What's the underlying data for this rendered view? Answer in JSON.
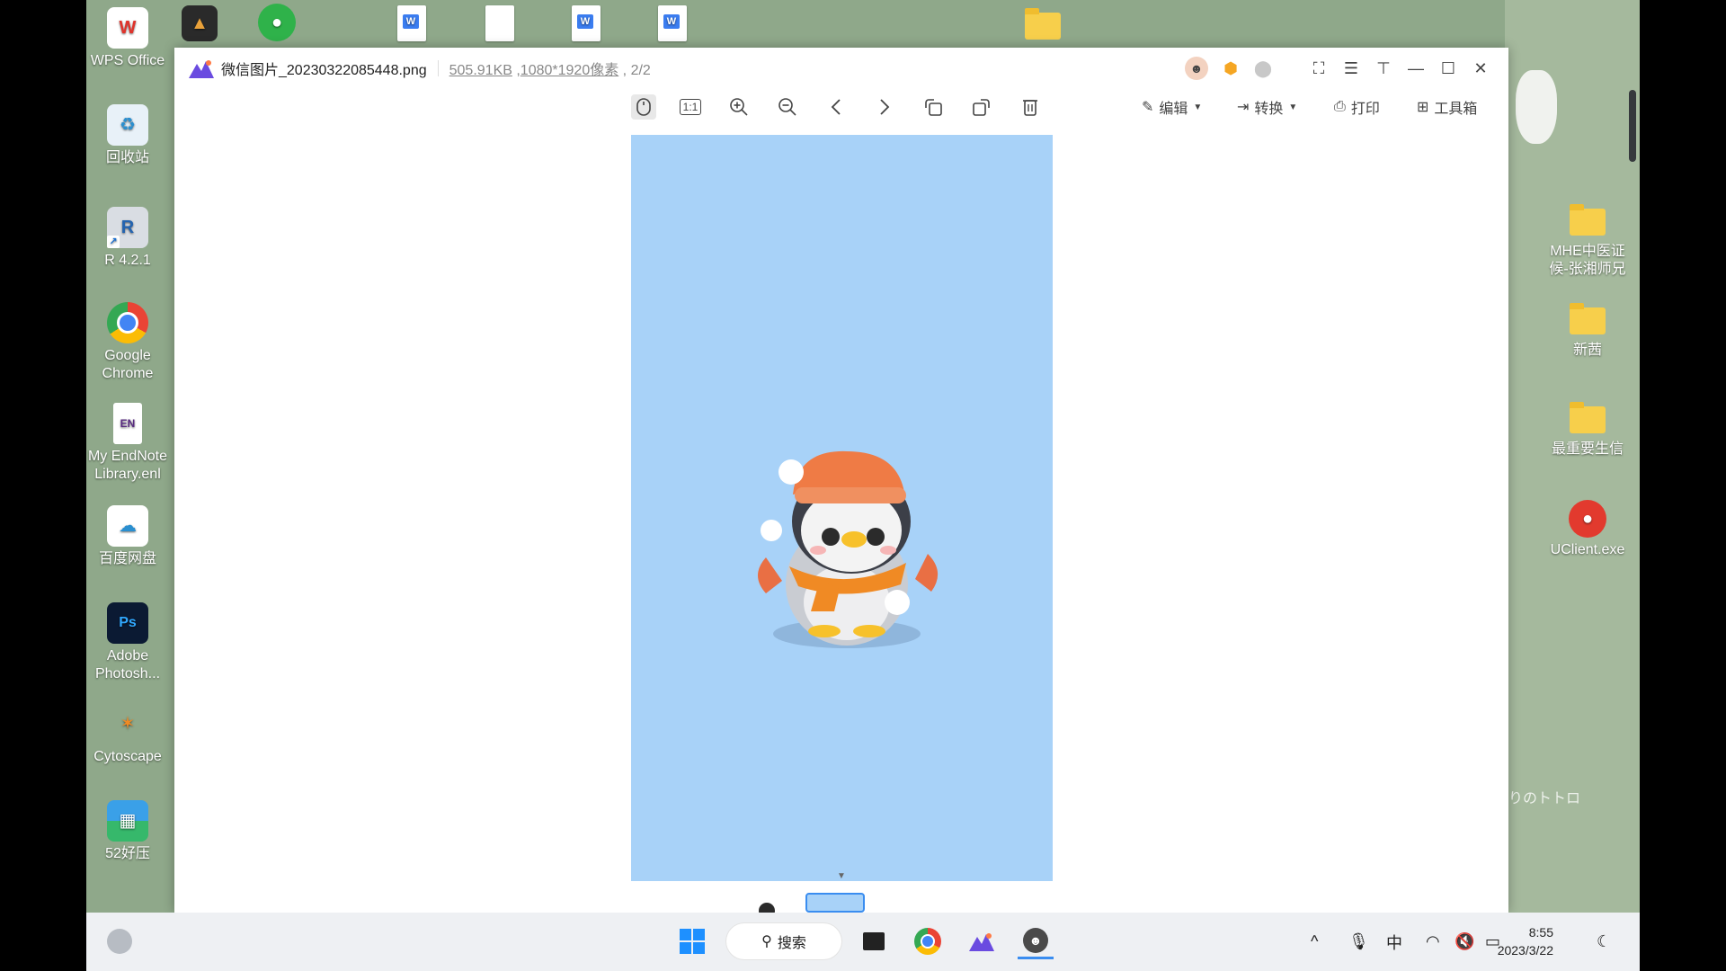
{
  "desktop": {
    "left_icons": [
      {
        "label": "WPS Office"
      },
      {
        "label": "回收站"
      },
      {
        "label": "R 4.2.1"
      },
      {
        "label": "Google Chrome"
      },
      {
        "label": "My EndNote Library.enl"
      },
      {
        "label": "百度网盘"
      },
      {
        "label": "Adobe Photosh..."
      },
      {
        "label": "Cytoscape"
      },
      {
        "label": "52好压"
      }
    ],
    "right_icons": [
      {
        "label": "MHE中医证候-张湘师兄"
      },
      {
        "label": "新茜"
      },
      {
        "label": "最重要生信"
      },
      {
        "label": "UClient.exe"
      }
    ],
    "wallpaper_text": "りのトトロ"
  },
  "viewer": {
    "title": "微信图片_20230322085448.png",
    "file_size": "505.91KB",
    "dimensions": "1080*1920像素",
    "page": "2/2",
    "edit_label": "编辑",
    "convert_label": "转换",
    "print_label": "打印",
    "toolbox_label": "工具箱",
    "ratio_label": "1:1"
  },
  "taskbar": {
    "search_label": "搜索",
    "ime_label": "中",
    "time": "8:55",
    "date": "2023/3/22"
  },
  "colors": {
    "canvas_bg": "#a8d2f8",
    "accent": "#3a8df0"
  }
}
